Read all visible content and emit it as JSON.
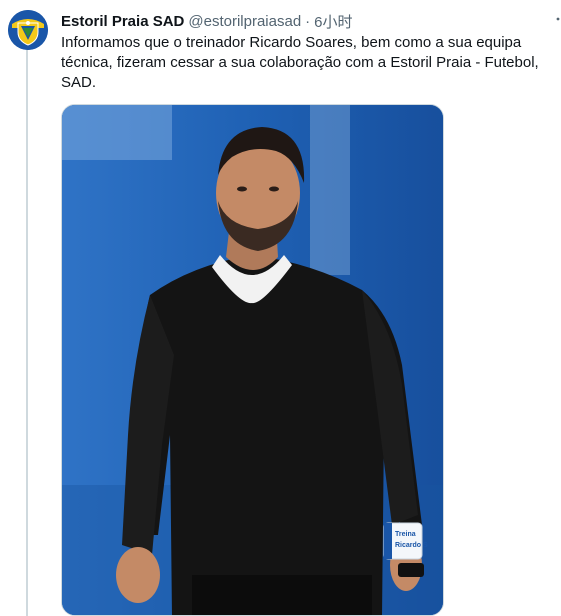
{
  "tweet": {
    "display_name": "Estoril Praia SAD",
    "handle": "@estorilpraiasad",
    "separator": "·",
    "time": "6小时",
    "more_icon": "more-vertical-icon",
    "text": "Informamos que o treinador Ricardo Soares, bem como a sua equipa técnica, fizeram cessar a sua colaboração com a Estoril Praia - Futebol, SAD.",
    "media": {
      "armband_text_1": "Treina",
      "armband_text_2": "Ricardo S"
    }
  },
  "colors": {
    "text_primary": "#0f1419",
    "text_secondary": "#536471",
    "thread_line": "#cfd9de",
    "photo_background": "#1e5fb3",
    "club_blue": "#1a56a8",
    "club_yellow": "#f4c91a"
  }
}
